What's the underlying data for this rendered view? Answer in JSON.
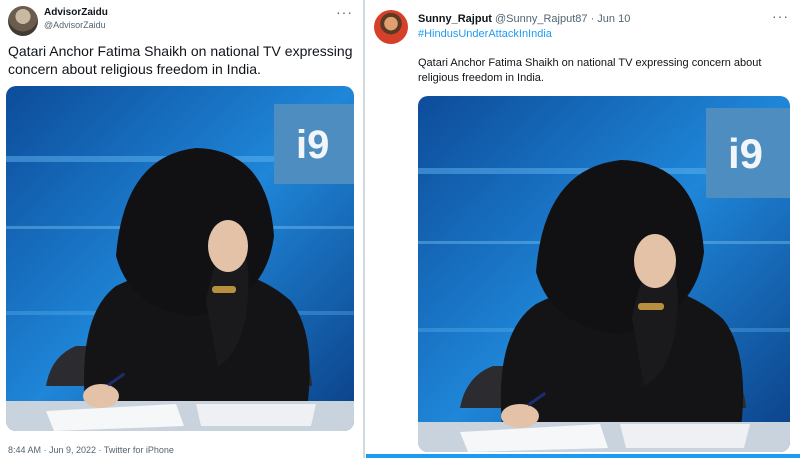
{
  "left_tweet": {
    "display_name": "AdvisorZaidu",
    "handle": "@AdvisorZaidu",
    "more_icon": "more-horizontal-icon",
    "text": "Qatari Anchor Fatima Shaikh on national TV expressing concern about religious freedom in India.",
    "timestamp": "8:44 AM · Jun 9, 2022 · Twitter for iPhone",
    "media_logo_text": "i9"
  },
  "right_tweet": {
    "display_name": "Sunny_Rajput",
    "handle_date": "@Sunny_Rajput87 · Jun 10",
    "hashtag": "#HindusUnderAttackInIndia",
    "more_icon": "more-horizontal-icon",
    "text": "Qatari Anchor Fatima Shaikh on national TV expressing concern about religious freedom in India.",
    "media_logo_text": "i9"
  },
  "colors": {
    "accent": "#1d9bf0",
    "secondary_text": "#536471",
    "studio_blue": "#1e7fd0"
  }
}
